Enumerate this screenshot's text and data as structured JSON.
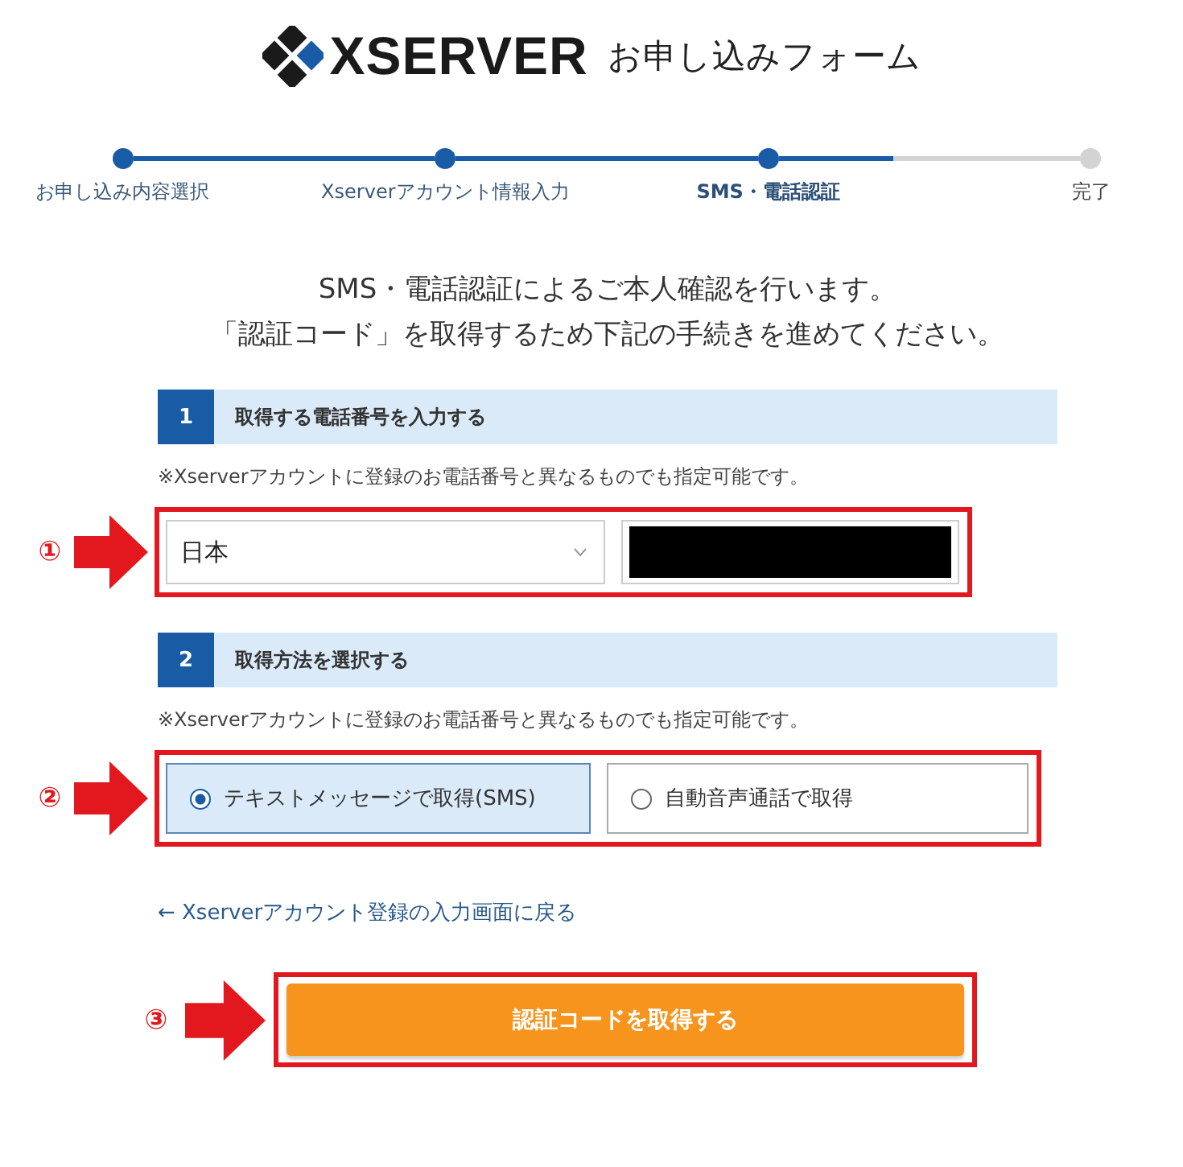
{
  "header": {
    "logo_text": "XSERVER",
    "title": "お申し込みフォーム"
  },
  "steps": {
    "items": [
      {
        "label": "お申し込み内容選択",
        "completed": true,
        "selected": false
      },
      {
        "label": "Xserverアカウント情報入力",
        "completed": true,
        "selected": false
      },
      {
        "label": "SMS・電話認証",
        "completed": false,
        "selected": true
      },
      {
        "label": "完了",
        "completed": false,
        "selected": false
      }
    ]
  },
  "intro": [
    "SMS・電話認証によるご本人確認を行います。",
    "「認証コード」を取得するため下記の手続きを進めてください。"
  ],
  "sections": [
    {
      "kind": "phone",
      "number": "1",
      "title": "取得する電話番号を入力する",
      "note": "※Xserverアカウントに登録のお電話番号と異なるものでも指定可能です。",
      "annotation": "①",
      "country": "日本",
      "phone_redacted": true
    },
    {
      "kind": "method",
      "number": "2",
      "title": "取得方法を選択する",
      "note": "※Xserverアカウントに登録のお電話番号と異なるものでも指定可能です。",
      "annotation": "②",
      "options": [
        {
          "label": "テキストメッセージで取得(SMS)",
          "selected": true
        },
        {
          "label": "自動音声通話で取得",
          "selected": false
        }
      ]
    }
  ],
  "back_link": "← Xserverアカウント登録の入力画面に戻る",
  "submit": {
    "label": "認証コードを取得する",
    "annotation": "③"
  }
}
